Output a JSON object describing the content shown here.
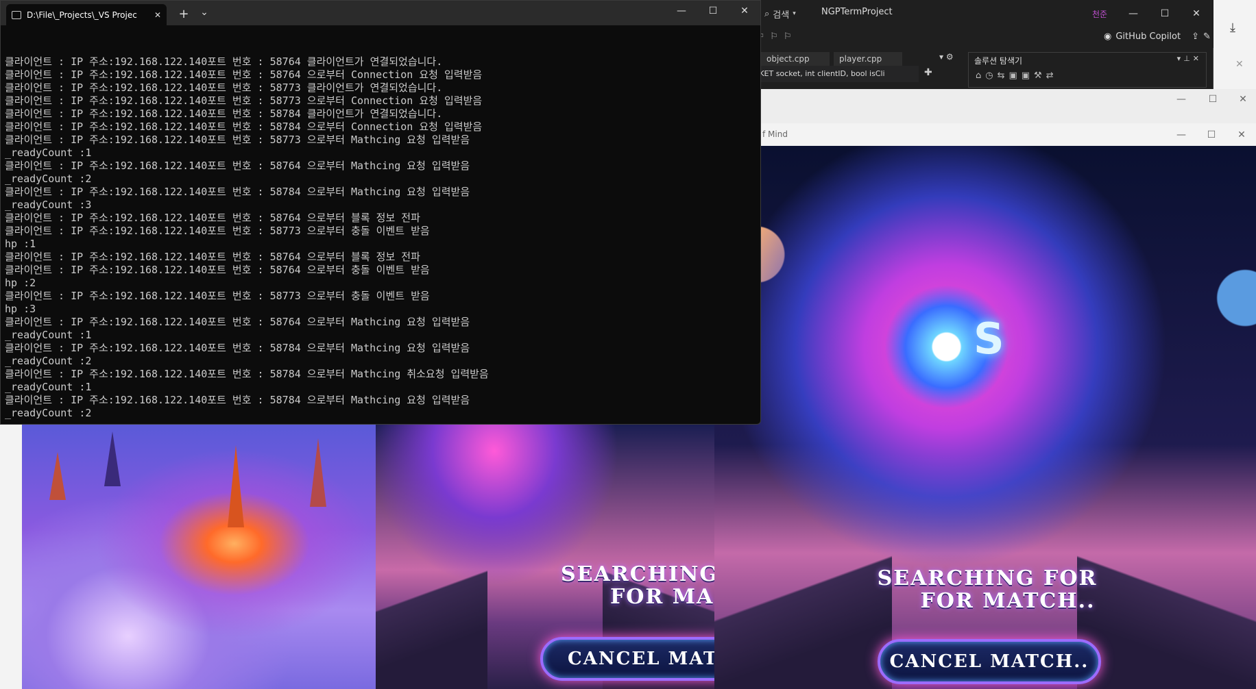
{
  "terminal": {
    "tab_title": "D:\\File\\_Projects\\_VS Projec",
    "new_tab_symbol": "+",
    "dropdown_symbol": "⌄",
    "close_tab_symbol": "✕",
    "minimize_symbol": "—",
    "maximize_symbol": "☐",
    "close_symbol": "✕",
    "lines": [
      "클라이언트 : IP 주소:192.168.122.140포트 번호 : 58764 클라이언트가 연결되었습니다.",
      "클라이언트 : IP 주소:192.168.122.140포트 번호 : 58764 으로부터 Connection 요청 입력받음",
      "클라이언트 : IP 주소:192.168.122.140포트 번호 : 58773 클라이언트가 연결되었습니다.",
      "클라이언트 : IP 주소:192.168.122.140포트 번호 : 58773 으로부터 Connection 요청 입력받음",
      "클라이언트 : IP 주소:192.168.122.140포트 번호 : 58784 클라이언트가 연결되었습니다.",
      "클라이언트 : IP 주소:192.168.122.140포트 번호 : 58784 으로부터 Connection 요청 입력받음",
      "클라이언트 : IP 주소:192.168.122.140포트 번호 : 58773 으로부터 Mathcing 요청 입력받음",
      "_readyCount :1",
      "클라이언트 : IP 주소:192.168.122.140포트 번호 : 58764 으로부터 Mathcing 요청 입력받음",
      "_readyCount :2",
      "클라이언트 : IP 주소:192.168.122.140포트 번호 : 58784 으로부터 Mathcing 요청 입력받음",
      "_readyCount :3",
      "클라이언트 : IP 주소:192.168.122.140포트 번호 : 58764 으로부터 블록 정보 전파",
      "클라이언트 : IP 주소:192.168.122.140포트 번호 : 58773 으로부터 충돌 이벤트 받음",
      "hp :1",
      "클라이언트 : IP 주소:192.168.122.140포트 번호 : 58764 으로부터 블록 정보 전파",
      "클라이언트 : IP 주소:192.168.122.140포트 번호 : 58764 으로부터 충돌 이벤트 받음",
      "hp :2",
      "클라이언트 : IP 주소:192.168.122.140포트 번호 : 58773 으로부터 충돌 이벤트 받음",
      "hp :3",
      "클라이언트 : IP 주소:192.168.122.140포트 번호 : 58764 으로부터 Mathcing 요청 입력받음",
      "_readyCount :1",
      "클라이언트 : IP 주소:192.168.122.140포트 번호 : 58784 으로부터 Mathcing 요청 입력받음",
      "_readyCount :2",
      "클라이언트 : IP 주소:192.168.122.140포트 번호 : 58784 으로부터 Mathcing 취소요청 입력받음",
      "_readyCount :1",
      "클라이언트 : IP 주소:192.168.122.140포트 번호 : 58784 으로부터 Mathcing 요청 입력받음",
      "_readyCount :2"
    ]
  },
  "vs": {
    "search_label": "검색",
    "project_name": "NGPTermProject",
    "avatar_initials": "천준",
    "copilot_label": "GitHub Copilot",
    "tabs": [
      "object.cpp",
      "player.cpp"
    ],
    "function_signature": "SOCKET socket, int clientID, bool isCli",
    "solution_explorer_title": "솔루션 탐색기"
  },
  "game_right": {
    "title_fragment": "f Mind",
    "logo_letter": "S",
    "status_line1": "SEARCHING FOR",
    "status_line2": "FOR MATCH..",
    "cancel_label": "CANCEL MATCH.."
  },
  "game_mid": {
    "status_line1": "SEARCHING",
    "status_line2": "FOR MA",
    "cancel_label": "CANCEL MATC"
  },
  "colors": {
    "terminal_bg": "#0c0c0c",
    "terminal_text": "#cccccc",
    "accent_pink": "#ff5ad8",
    "accent_blue": "#5aa0ff"
  }
}
